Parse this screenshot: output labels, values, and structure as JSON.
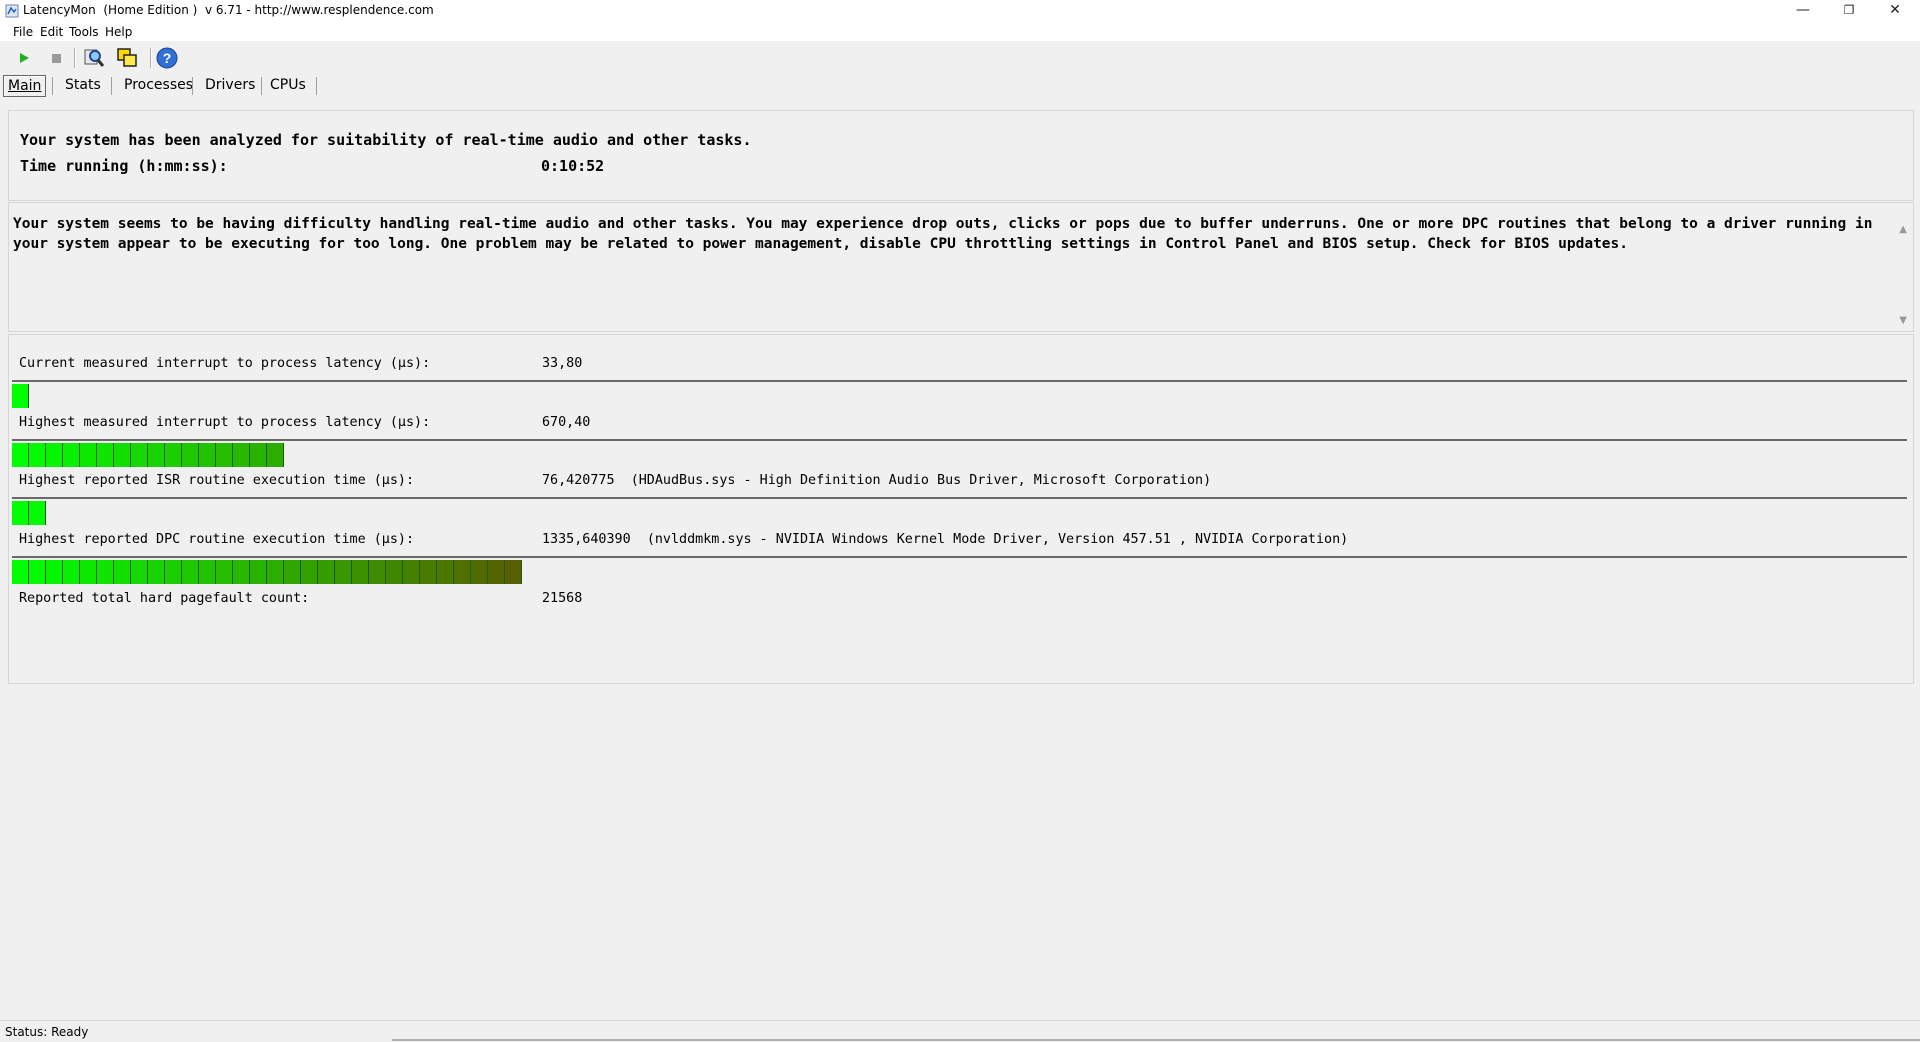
{
  "window": {
    "title": "LatencyMon  (Home Edition )  v 6.71 - http://www.resplendence.com",
    "minimize": "—",
    "restore": "❐",
    "close": "✕"
  },
  "menu": [
    {
      "label": "File"
    },
    {
      "label": "Edit"
    },
    {
      "label": "Tools"
    },
    {
      "label": "Help"
    }
  ],
  "tabs": [
    {
      "label": "Main",
      "active": true
    },
    {
      "label": "Stats"
    },
    {
      "label": "Processes"
    },
    {
      "label": "Drivers"
    },
    {
      "label": "CPUs"
    }
  ],
  "summary": {
    "analyzed_text": "Your system has been analyzed for suitability of real-time audio and other tasks.",
    "time_label": "Time running (h:mm:ss):",
    "time_value": "0:10:52"
  },
  "message": "Your system seems to be having difficulty handling real-time audio and other tasks. You may experience drop outs, clicks or pops due to buffer underruns. One or more DPC routines that belong to a driver running in your system appear to be executing for too long. One problem may be related to power management, disable CPU throttling settings in Control Panel and BIOS setup. Check for BIOS updates.",
  "metrics": {
    "current_latency": {
      "label": "Current measured interrupt to process latency (µs):",
      "value": "33,80",
      "bar_segments": 1
    },
    "highest_latency": {
      "label": "Highest measured interrupt to process latency (µs):",
      "value": "670,40",
      "bar_segments": 16
    },
    "highest_isr": {
      "label": "Highest reported ISR routine execution time (µs):",
      "value": "76,420775",
      "detail": "(HDAudBus.sys - High Definition Audio Bus Driver, Microsoft Corporation)",
      "bar_segments": 2
    },
    "highest_dpc": {
      "label": "Highest reported DPC routine execution time (µs):",
      "value": "1335,640390",
      "detail": "(nvlddmkm.sys - NVIDIA Windows Kernel Mode Driver, Version 457.51 , NVIDIA Corporation)",
      "bar_segments": 30
    },
    "pagefault": {
      "label": "Reported total hard pagefault count:",
      "value": "21568"
    }
  },
  "status": {
    "text": "Status: Ready"
  },
  "colors": {
    "bar_start": "#00ff00",
    "bar_end": "#5a5a00"
  }
}
